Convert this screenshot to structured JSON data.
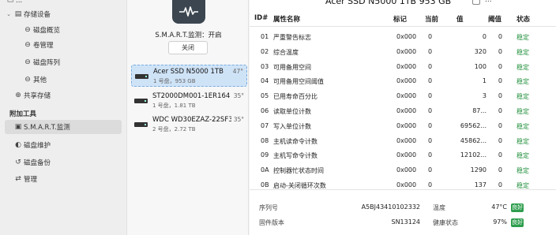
{
  "sidebar": {
    "top_partial": "...",
    "group_storage": "存储设备",
    "items": [
      {
        "label": "磁盘概览",
        "icon": "disk-icon"
      },
      {
        "label": "卷管理",
        "icon": "volume-icon"
      },
      {
        "label": "磁盘阵列",
        "icon": "raid-icon"
      },
      {
        "label": "其他",
        "icon": "other-disk-icon"
      }
    ],
    "share": "共享存储",
    "section_tools": "附加工具",
    "tools": [
      {
        "label": "S.M.A.R.T.监测",
        "icon": "smart-icon",
        "active": true
      },
      {
        "label": "磁盘维护",
        "icon": "maintenance-icon"
      },
      {
        "label": "磁盘备份",
        "icon": "backup-icon"
      },
      {
        "label": "管理",
        "icon": "manage-icon"
      }
    ]
  },
  "middle": {
    "status": "S.M.A.R.T.监测：开启",
    "close_label": "关闭",
    "disks": [
      {
        "name": "Acer SSD N5000 1TB",
        "sub": "1 号盘，953 GB",
        "temp": "47°",
        "selected": true
      },
      {
        "name": "ST2000DM001-1ER164",
        "sub": "1 号盘，1.81 TB",
        "temp": "35°"
      },
      {
        "name": "WDC WD30EZAZ-22SF3...",
        "sub": "2 号盘，2.72 TB",
        "temp": "35°"
      }
    ]
  },
  "main": {
    "title": "Acer SSD N5000 1TB  953 GB",
    "checkbox_label": "...",
    "headers": {
      "id": "ID#",
      "name": "属性名称",
      "flag": "标记",
      "current": "当前",
      "value": "值",
      "threshold": "阈值",
      "status": "状态"
    },
    "rows": [
      {
        "id": "01",
        "name": "严重警告标志",
        "flag": "0x000",
        "current": "0",
        "value": "0",
        "threshold": "0",
        "status": "稳定"
      },
      {
        "id": "02",
        "name": "综合温度",
        "flag": "0x000",
        "current": "0",
        "value": "320",
        "threshold": "0",
        "status": "稳定"
      },
      {
        "id": "03",
        "name": "可用备用空间",
        "flag": "0x000",
        "current": "0",
        "value": "100",
        "threshold": "0",
        "status": "稳定"
      },
      {
        "id": "04",
        "name": "可用备用空间阈值",
        "flag": "0x000",
        "current": "0",
        "value": "1",
        "threshold": "0",
        "status": "稳定"
      },
      {
        "id": "05",
        "name": "已用寿命百分比",
        "flag": "0x000",
        "current": "0",
        "value": "3",
        "threshold": "0",
        "status": "稳定"
      },
      {
        "id": "06",
        "name": "读取单位计数",
        "flag": "0x000",
        "current": "0",
        "value": "87...",
        "threshold": "0",
        "status": "稳定"
      },
      {
        "id": "07",
        "name": "写入单位计数",
        "flag": "0x000",
        "current": "0",
        "value": "69562...",
        "threshold": "0",
        "status": "稳定"
      },
      {
        "id": "08",
        "name": "主机读命令计数",
        "flag": "0x000",
        "current": "0",
        "value": "45862...",
        "threshold": "0",
        "status": "稳定"
      },
      {
        "id": "09",
        "name": "主机写命令计数",
        "flag": "0x000",
        "current": "0",
        "value": "12102...",
        "threshold": "0",
        "status": "稳定"
      },
      {
        "id": "0A",
        "name": "控制器忙状态时间",
        "flag": "0x000",
        "current": "0",
        "value": "1290",
        "threshold": "0",
        "status": "稳定"
      },
      {
        "id": "0B",
        "name": "启动-关闭循环次数",
        "flag": "0x000",
        "current": "0",
        "value": "137",
        "threshold": "0",
        "status": "稳定"
      }
    ],
    "info": {
      "serial_label": "序列号",
      "serial_value": "A5BJ43410102332",
      "temp_label": "温度",
      "temp_value": "47°C",
      "temp_badge": "良好",
      "firmware_label": "固件版本",
      "firmware_value": "SN13124",
      "health_label": "健康状态",
      "health_value": "97%",
      "health_badge": "良好"
    }
  }
}
